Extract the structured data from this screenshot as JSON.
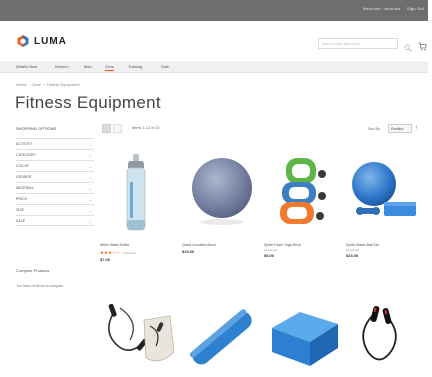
{
  "topbar": {
    "links": [
      "Welcome, Veronica",
      "Sign Out"
    ]
  },
  "header": {
    "logo_text": "LUMA",
    "search_placeholder": "Search entire store here...",
    "search_icon": "search-icon",
    "cart_icon": "cart-icon"
  },
  "nav": {
    "items": [
      "What's New",
      "Women",
      "Men",
      "Gear",
      "Training",
      "Sale"
    ],
    "active_index": 3
  },
  "breadcrumb": [
    "Home",
    "Gear",
    "Fitness Equipment"
  ],
  "page_title": "Fitness Equipment",
  "sidebar": {
    "shop_by": "SHOPPING OPTIONS",
    "filters": [
      "ACTIVITY",
      "CATEGORY",
      "COLOR",
      "GENDER",
      "MATERIAL",
      "PRICE",
      "SIZE",
      "SALE"
    ],
    "compare_title": "Compare Products",
    "compare_text": "You have no items to compare."
  },
  "toolbar": {
    "amount": "Items 1-12 of 23",
    "sort_label": "Sort By",
    "sort_value": "Position"
  },
  "products": [
    {
      "name": "Affirm Water Bottle",
      "rating_stars": 3,
      "reviews": "3 Reviews",
      "price_prefix": "",
      "price": "$7.00"
    },
    {
      "name": "Quest Lumaflex Band",
      "rating_stars": 0,
      "reviews": "",
      "price_prefix": "",
      "price": "$19.00"
    },
    {
      "name": "Sprite Foam Yoga Brick",
      "rating_stars": 0,
      "reviews": "",
      "price_prefix": "As low as",
      "price": "$5.00"
    },
    {
      "name": "Sprite Stasis Ball Set",
      "rating_stars": 0,
      "reviews": "",
      "price_prefix": "As low as",
      "price": "$23.00"
    }
  ],
  "colors": {
    "accent": "#ff5501",
    "topbar": "#6e6e6e",
    "logo_orange": "#f26322",
    "logo_blue": "#1979c3"
  }
}
